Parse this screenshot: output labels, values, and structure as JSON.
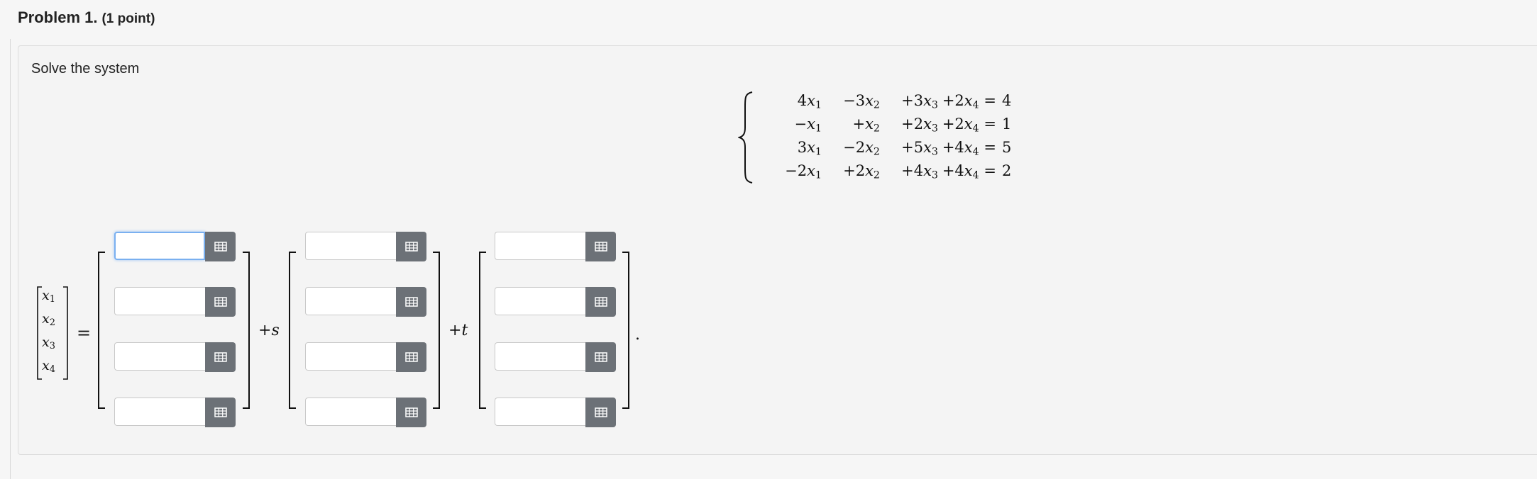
{
  "header": {
    "title": "Problem 1.",
    "points": "(1 point)"
  },
  "prompt": "Solve the system",
  "system": {
    "rows": [
      [
        "4x1",
        "−3x2",
        "+3x3",
        "+2x4 =",
        "4"
      ],
      [
        "−x1",
        "+x2",
        "+2x3",
        "+2x4 =",
        "1"
      ],
      [
        "3x1",
        "−2x2",
        "+5x3",
        "+4x4 =",
        "5"
      ],
      [
        "−2x1",
        "+2x2",
        "+4x3",
        "+4x4 =",
        "2"
      ]
    ]
  },
  "vector_labels": [
    "x1",
    "x2",
    "x3",
    "x4"
  ],
  "equals": "=",
  "param_s": "+s",
  "param_t": "+t",
  "end_period": ".",
  "inputs": {
    "col0": [
      "",
      "",
      "",
      ""
    ],
    "col1": [
      "",
      "",
      "",
      ""
    ],
    "col2": [
      "",
      "",
      "",
      ""
    ]
  },
  "icons": {
    "matrix_button": "grid-icon"
  },
  "colors": {
    "button_bg": "#6c7177",
    "focus_border": "#7ab0f0"
  }
}
